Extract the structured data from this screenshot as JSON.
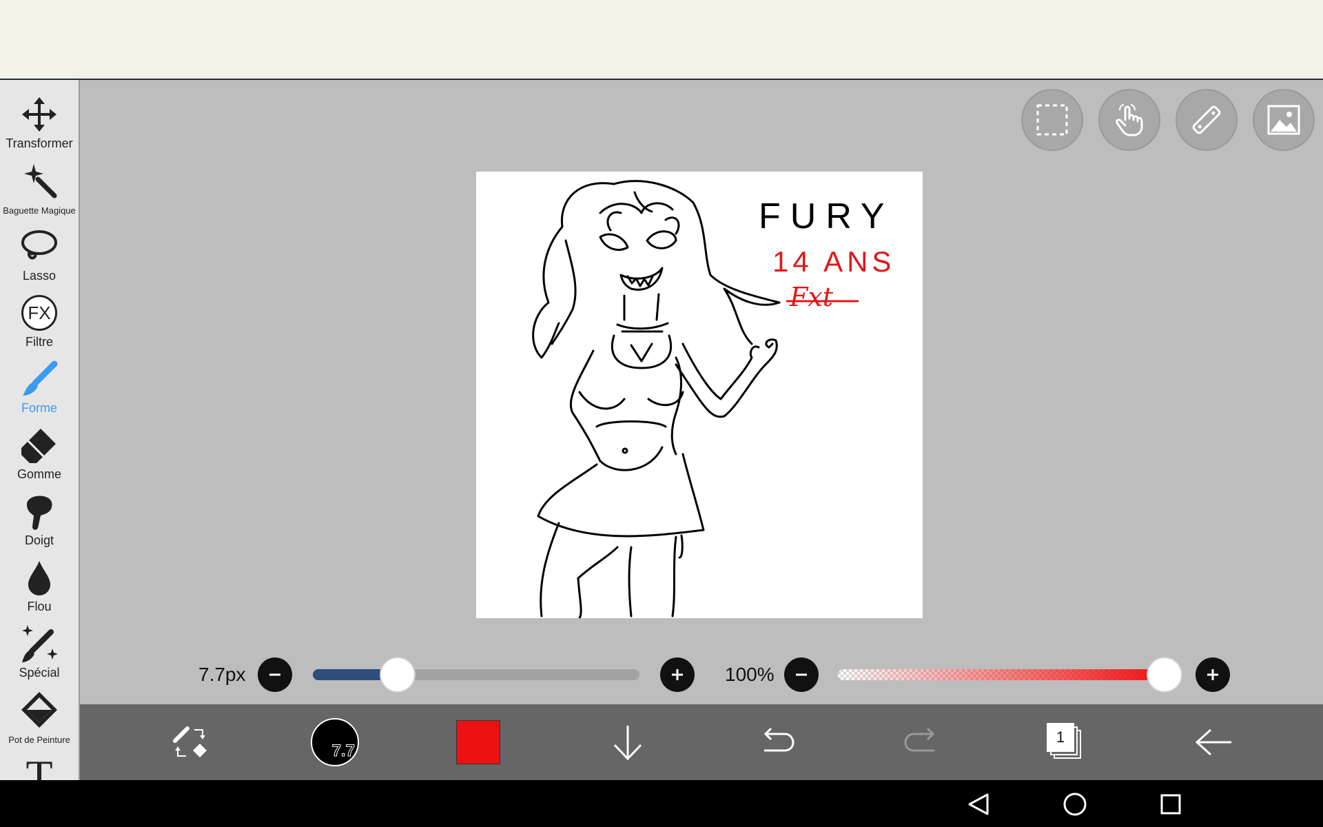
{
  "sidebar": {
    "tools": [
      {
        "label": "Transformer",
        "icon": "move-arrows-icon"
      },
      {
        "label": "Baguette Magique",
        "icon": "magic-wand-icon"
      },
      {
        "label": "Lasso",
        "icon": "lasso-icon"
      },
      {
        "label": "Filtre",
        "icon": "fx-icon",
        "icon_text": "FX"
      },
      {
        "label": "Forme",
        "icon": "brush-icon",
        "active": true
      },
      {
        "label": "Gomme",
        "icon": "eraser-icon"
      },
      {
        "label": "Doigt",
        "icon": "finger-icon"
      },
      {
        "label": "Flou",
        "icon": "drop-icon"
      },
      {
        "label": "Spécial",
        "icon": "special-brush-icon"
      },
      {
        "label": "Pot de Peinture",
        "icon": "paint-bucket-icon"
      },
      {
        "label": "",
        "icon": "text-icon",
        "icon_text": "T"
      }
    ]
  },
  "canvas": {
    "text_title": "FURY",
    "text_age": "14 ANS",
    "text_signature": "Fxt"
  },
  "brush": {
    "size_label": "7.7px",
    "size_fraction": 0.26,
    "opacity_label": "100%",
    "opacity_fraction": 1.0,
    "brush_badge": "7.7"
  },
  "layers": {
    "count_label": "1"
  },
  "colors": {
    "accent": "#3a9bf0",
    "current_color": "#ee1111",
    "size_track_fill": "#2e4d7a",
    "bottom_bar": "#666666"
  }
}
